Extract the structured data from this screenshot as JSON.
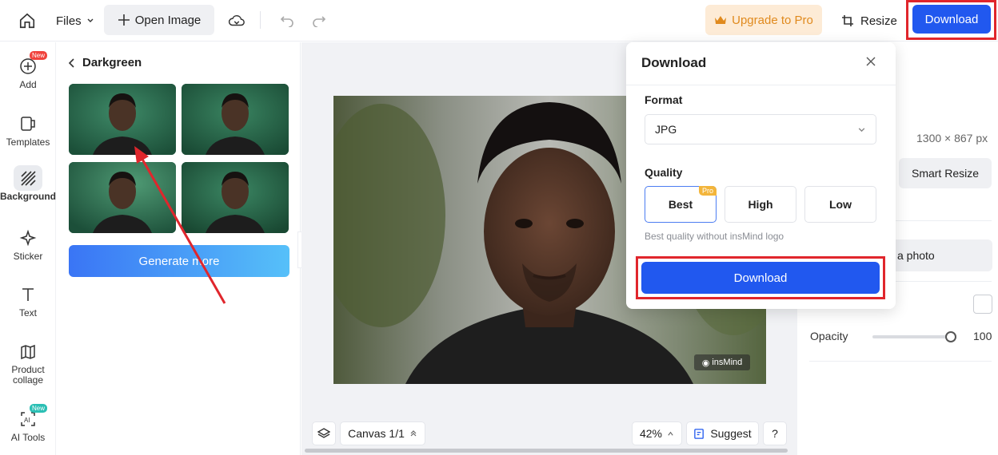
{
  "topbar": {
    "files_label": "Files",
    "open_image_label": "Open Image",
    "upgrade_label": "Upgrade to Pro",
    "resize_label": "Resize",
    "download_label": "Download"
  },
  "rail": {
    "items": [
      {
        "label": "Add",
        "badge": "New",
        "icon": "add-icon"
      },
      {
        "label": "Templates",
        "icon": "templates-icon"
      },
      {
        "label": "Background",
        "icon": "background-icon",
        "active": true
      },
      {
        "label": "Sticker",
        "icon": "sticker-icon"
      },
      {
        "label": "Text",
        "icon": "text-icon"
      },
      {
        "label": "Product collage",
        "line1": "Product",
        "line2": "collage",
        "icon": "collage-icon"
      },
      {
        "label": "AI Tools",
        "badge": "New",
        "icon": "ai-tools-icon"
      }
    ]
  },
  "panel": {
    "title": "Darkgreen",
    "generate_label": "Generate more"
  },
  "canvas": {
    "canvas_label": "Canvas 1/1",
    "zoom": "42%",
    "suggest_label": "Suggest",
    "help_label": "?",
    "watermark": "insMind"
  },
  "right_panel": {
    "size_text": "1300 × 867 px",
    "smart_resize_label": "Smart Resize",
    "photo_label": "a photo",
    "opacity_label": "Opacity",
    "opacity_value": "100",
    "opacity_level": 1.0
  },
  "dialog": {
    "title": "Download",
    "format_label": "Format",
    "format_value": "JPG",
    "quality_label": "Quality",
    "quality_options": [
      "Best",
      "High",
      "Low"
    ],
    "selected_quality": "Best",
    "pro_badge": "Pro",
    "quality_note": "Best quality without insMind logo",
    "download_label": "Download"
  },
  "colors": {
    "accent": "#2158ef",
    "highlight": "#e0262c",
    "upgrade_bg": "#fdebd6",
    "upgrade_text": "#e08a1e",
    "thumb_bg": "#24624a"
  }
}
